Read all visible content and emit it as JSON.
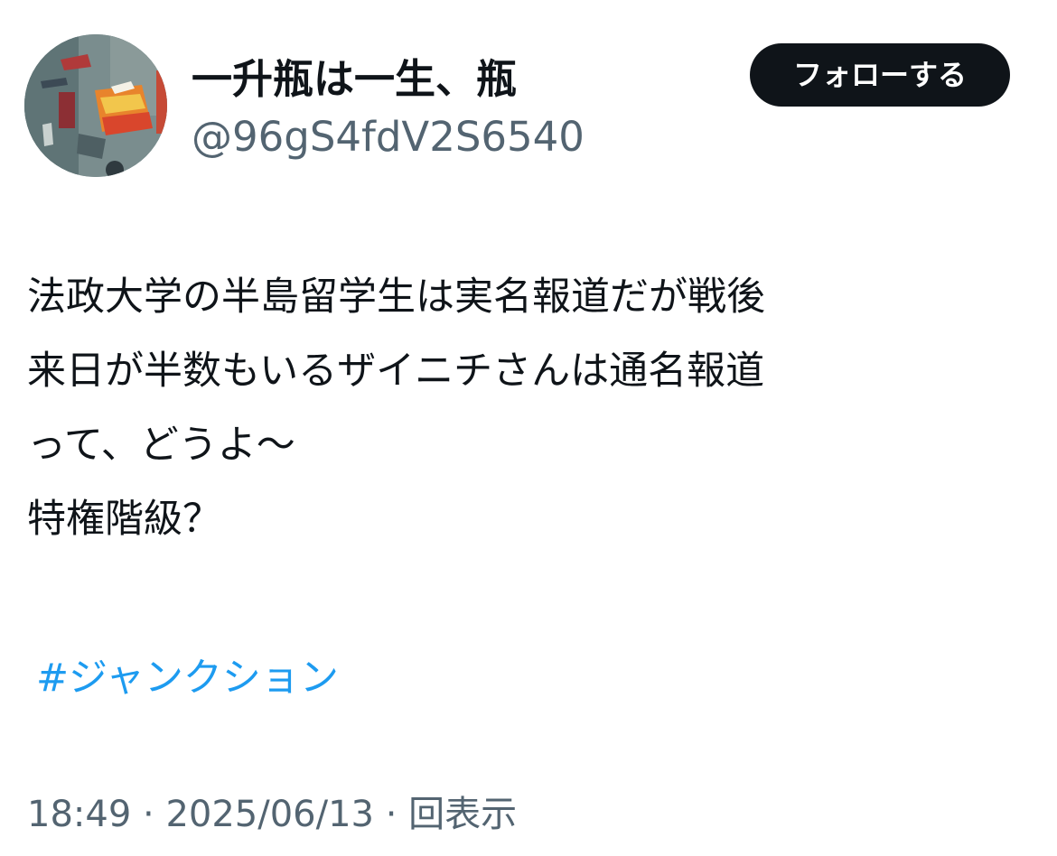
{
  "author": {
    "display_name": "一升瓶は一生、瓶",
    "handle": "@96gS4fdV2S6540",
    "avatar_icon": "abstract-painting-avatar"
  },
  "follow_button": {
    "label": "フォローする"
  },
  "tweet": {
    "lines": [
      "法政大学の半島留学生は実名報道だが戦後",
      "来日が半数もいるザイニチさんは通名報道",
      "って、どうよ～",
      "特権階級？"
    ],
    "hashtag": "#ジャンクション"
  },
  "meta": {
    "time": "18:49",
    "separator": " · ",
    "date": "2025/06/13",
    "views_label": "回表示"
  },
  "colors": {
    "text": "#0f1419",
    "secondary": "#536471",
    "link": "#1d9bf0",
    "button_bg": "#0f1419"
  }
}
